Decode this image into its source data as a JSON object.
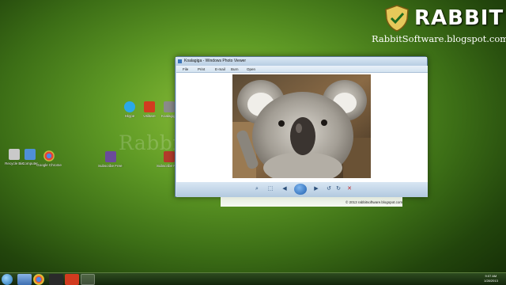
{
  "watermark": "RabbitSoftware.blogspot.com",
  "brand": {
    "name": "RABBIT",
    "url": "RabbitSoftware.blogspot.com"
  },
  "desktop_icons": [
    {
      "label": "Recycle Bin",
      "icon": "recycle-bin-icon",
      "color": "#c9c9c9"
    },
    {
      "label": "Computer",
      "icon": "computer-icon",
      "color": "#4f8fd6"
    },
    {
      "label": "Google Chrome",
      "icon": "chrome-icon",
      "color": "#e0453a"
    },
    {
      "label": "Skype",
      "icon": "skype-icon",
      "color": "#2aa8e8"
    },
    {
      "label": "Utilitare",
      "icon": "app-icon",
      "color": "#d23b1f"
    },
    {
      "label": "Koalagiga",
      "icon": "image-icon",
      "color": "#8a8a8a"
    },
    {
      "label": "Subscribe Free Ebooks",
      "icon": "folder-icon",
      "color": "#6b4b9a"
    },
    {
      "label": "Subscribe Photos",
      "icon": "image-icon",
      "color": "#b33a2a"
    }
  ],
  "viewer": {
    "title": "Koalagiga - Windows Photo Viewer",
    "menu": [
      "File",
      "Print",
      "E-mail",
      "Burn",
      "Open"
    ]
  },
  "copyright": "© 2013 rabbitsoftware.blogspot.com",
  "taskbar": {
    "time": "9:07 AM",
    "date": "1/28/2013"
  },
  "colors": {
    "accent": "#3a74b8",
    "desktop": "#5f9a25"
  }
}
